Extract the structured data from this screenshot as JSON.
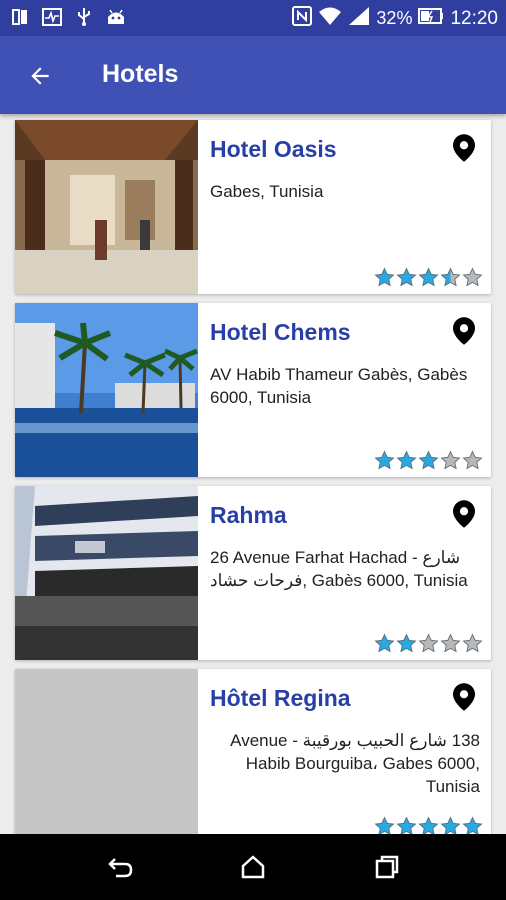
{
  "status_bar": {
    "icons": [
      "sim-icon",
      "activity-icon",
      "usb-icon",
      "android-icon"
    ],
    "battery_percent": "32%",
    "time": "12:20"
  },
  "app_bar": {
    "title": "Hotels"
  },
  "hotels": [
    {
      "name": "Hotel Oasis",
      "address": "Gabes, Tunisia",
      "rating": 3.5,
      "image": "lobby-photo"
    },
    {
      "name": "Hotel Chems",
      "address": "AV Habib Thameur Gabès, Gabès 6000, Tunisia",
      "rating": 3,
      "image": "pool-palms-photo"
    },
    {
      "name": "Rahma",
      "address": "26 Avenue Farhat Hachad - شارع فرحات حشاد, Gabès 6000, Tunisia",
      "rating": 2,
      "image": "building-photo"
    },
    {
      "name": "Hôtel Regina",
      "address": "138 شارع الحبيب بورقيبة - Avenue Habib Bourguiba، Gabes 6000, Tunisia",
      "rating": 5,
      "image": "placeholder"
    }
  ],
  "colors": {
    "status_bar": "#303f9f",
    "app_bar": "#3f51b5",
    "name_text": "#283fa8",
    "star_filled": "#29a9e1",
    "star_empty": "#b8b8b8"
  }
}
